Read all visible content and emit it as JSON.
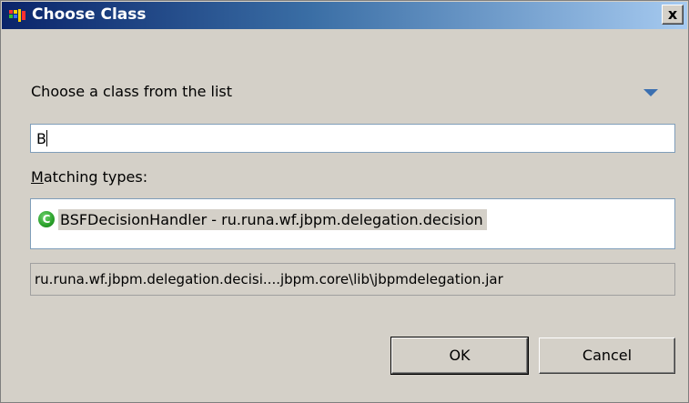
{
  "window": {
    "title": "Choose Class",
    "close_label": "x"
  },
  "dialog": {
    "instruction": "Choose a class from the list",
    "filter_value": "B",
    "matching_label_mnemonic": "M",
    "matching_label_rest": "atching types:",
    "results": [
      {
        "icon": "class-icon",
        "icon_glyph": "C",
        "label": "BSFDecisionHandler - ru.runa.wf.jbpm.delegation.decision"
      }
    ],
    "qualifier": "ru.runa.wf.jbpm.delegation.decisi....jbpm.core\\lib\\jbpmdelegation.jar"
  },
  "buttons": {
    "ok": "OK",
    "cancel": "Cancel"
  }
}
